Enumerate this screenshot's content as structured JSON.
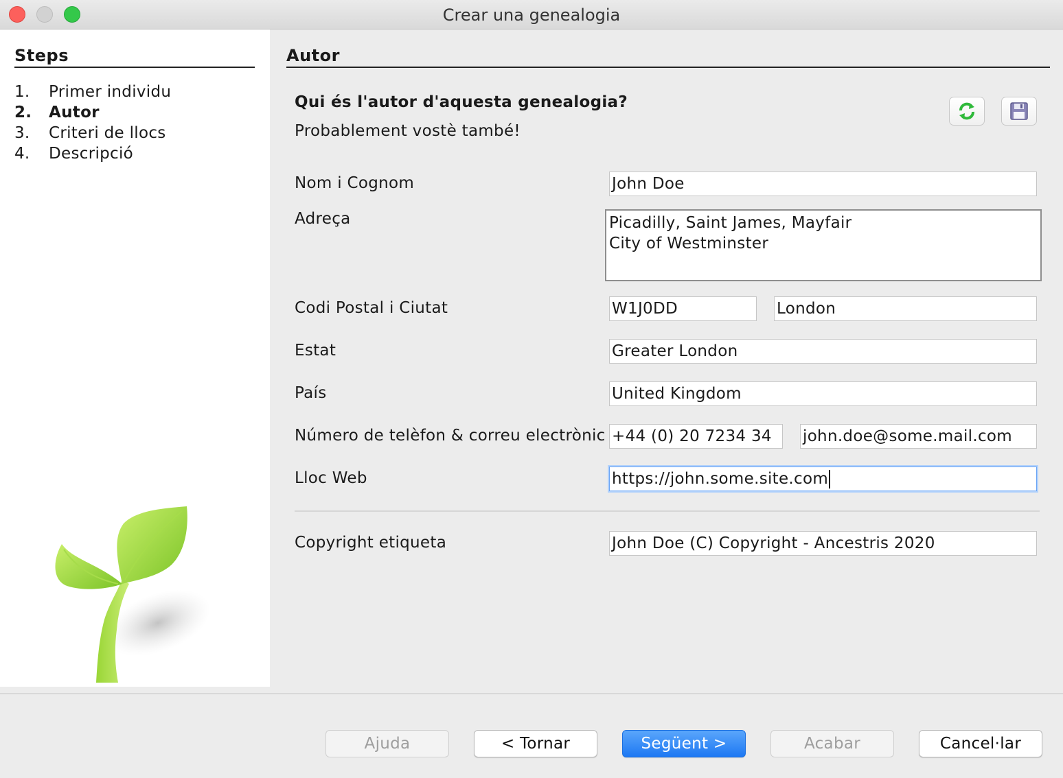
{
  "window": {
    "title": "Crear una genealogia"
  },
  "sidebar": {
    "heading": "Steps",
    "steps": [
      {
        "num": "1.",
        "label": "Primer individu"
      },
      {
        "num": "2.",
        "label": "Autor"
      },
      {
        "num": "3.",
        "label": "Criteri de llocs"
      },
      {
        "num": "4.",
        "label": "Descripció"
      }
    ],
    "active_step": 2
  },
  "main": {
    "heading": "Autor",
    "question": "Qui és l'autor d'aquesta genealogia?",
    "subtitle": "Probablement vostè també!",
    "icons": [
      "refresh-icon",
      "save-icon"
    ],
    "fields": {
      "name": {
        "label": "Nom i Cognom",
        "value": "John Doe"
      },
      "address": {
        "label": "Adreça",
        "lines": [
          "Picadilly, Saint James, Mayfair",
          "City of Westminster"
        ]
      },
      "postal_city": {
        "label": "Codi Postal i Ciutat",
        "postal": "W1J0DD",
        "city": "London"
      },
      "state": {
        "label": "Estat",
        "value": "Greater London"
      },
      "country": {
        "label": "País",
        "value": "United Kingdom"
      },
      "phone_email": {
        "label": "Número de telèfon & correu electrònic",
        "phone": "+44 (0) 20 7234 34",
        "email": "john.doe@some.mail.com"
      },
      "website": {
        "label": "Lloc Web",
        "value": "https://john.some.site.com"
      },
      "copyright": {
        "label": "Copyright etiqueta",
        "value": "John Doe (C) Copyright - Ancestris 2020"
      }
    }
  },
  "footer": {
    "help": "Ajuda",
    "back": "< Tornar",
    "next": "Següent >",
    "finish": "Acabar",
    "cancel": "Cancel·lar"
  },
  "colors": {
    "primary_button": "#1d78f3",
    "focus_ring": "#6aa5f5"
  }
}
